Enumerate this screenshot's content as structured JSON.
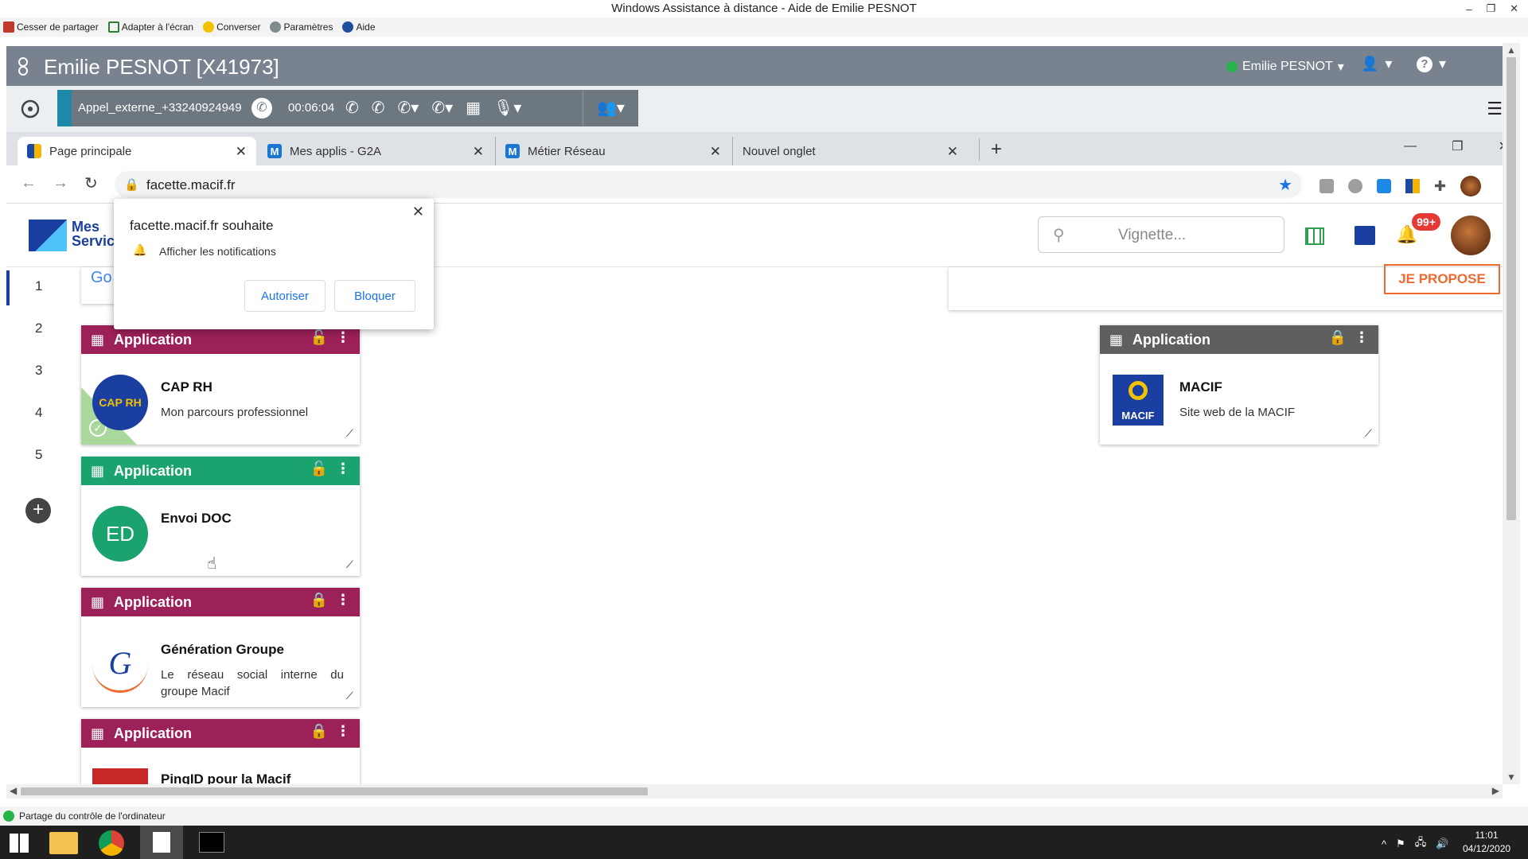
{
  "remote_window": {
    "title": "Windows Assistance à distance - Aide de Emilie PESNOT",
    "toolbar": [
      {
        "label": "Cesser de partager",
        "icon": "stop-share-icon"
      },
      {
        "label": "Adapter à l'écran",
        "icon": "fit-screen-icon"
      },
      {
        "label": "Converser",
        "icon": "chat-icon"
      },
      {
        "label": "Paramètres",
        "icon": "settings-icon"
      },
      {
        "label": "Aide",
        "icon": "help-icon"
      }
    ],
    "status_text": "Partage du contrôle de l'ordinateur"
  },
  "app": {
    "title": "Emilie PESNOT [X41973]",
    "user_name": "Emilie PESNOT",
    "status_color": "#27b24a"
  },
  "call": {
    "name": "Appel_externe_+33240924949",
    "time": "00:06:04"
  },
  "browser": {
    "tabs": [
      {
        "label": "Page principale",
        "favicon": "windows-icon",
        "active": true
      },
      {
        "label": "Mes applis - G2A",
        "favicon": "M",
        "active": false
      },
      {
        "label": "Métier Réseau",
        "favicon": "M",
        "active": false
      },
      {
        "label": "Nouvel onglet",
        "favicon": "",
        "active": false
      }
    ],
    "url": "facette.macif.fr"
  },
  "notification_prompt": {
    "title": "facette.macif.fr souhaite",
    "message": "Afficher les notifications",
    "allow": "Autoriser",
    "block": "Bloquer"
  },
  "site": {
    "logo_text": "Mes Servic",
    "search_placeholder": "Vignette...",
    "notif_badge": "99+",
    "propose_button": "JE PROPOSE",
    "partial_logo_text": "Go",
    "nav_numbers": [
      "1",
      "2",
      "3",
      "4",
      "5"
    ]
  },
  "cards": [
    {
      "type": "Application",
      "title": "CAP RH",
      "subtitle": "Mon parcours professionnel",
      "color": "#9c2158",
      "logo_text": "CAP RH"
    },
    {
      "type": "Application",
      "title": "Envoi DOC",
      "subtitle": "",
      "color": "#1aa36f",
      "logo_text": "ED"
    },
    {
      "type": "Application",
      "title": "Génération Groupe",
      "subtitle": "Le réseau social interne du groupe Macif",
      "color": "#9c2158",
      "logo_text": "G"
    },
    {
      "type": "Application",
      "title": "PingID pour la Macif",
      "subtitle": "",
      "color": "#9c2158",
      "logo_text": ""
    },
    {
      "type": "Application",
      "title": "MACIF",
      "subtitle": "Site web de la MACIF",
      "color": "#5f5f5f",
      "logo_text": "MACIF"
    }
  ],
  "taskbar": {
    "time": "11:01",
    "date": "04/12/2020"
  }
}
